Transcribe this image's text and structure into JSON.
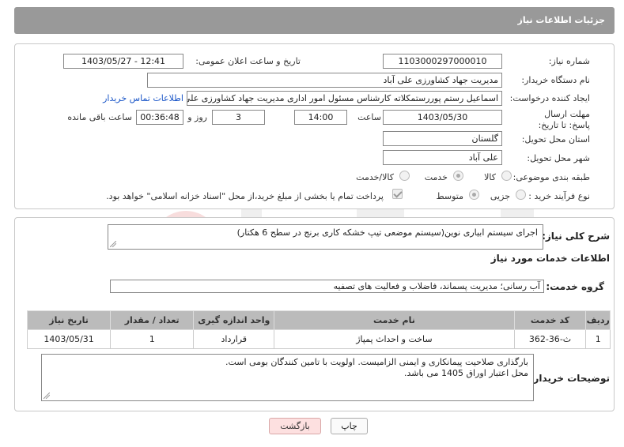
{
  "header": {
    "title": "جزئیات اطلاعات نیاز"
  },
  "need_info": {
    "need_number_label": "شماره نیاز:",
    "need_number": "1103000297000010",
    "announce_label": "تاریخ و ساعت اعلان عمومی:",
    "announce_value": "1403/05/27 - 12:41",
    "buyer_org_label": "نام دستگاه خریدار:",
    "buyer_org": "مدیریت جهاد کشاورزی علی آباد",
    "requester_label": "ایجاد کننده درخواست:",
    "requester": "اسماعیل رستم پوررستمکلاته کارشناس مسئول امور اداری مدیریت جهاد کشاورزی علی آباد",
    "contact_link": "اطلاعات تماس خریدار",
    "deadline_label": "مهلت ارسال پاسخ: تا تاریخ:",
    "deadline_date": "1403/05/30",
    "time_label": "ساعت",
    "deadline_time": "14:00",
    "days_value": "3",
    "days_label": "روز و",
    "remaining_time": "00:36:48",
    "remaining_label": "ساعت باقی مانده",
    "province_label": "استان محل تحویل:",
    "province": "گلستان",
    "city_label": "شهر محل تحویل:",
    "city": "علی آباد",
    "category_label": "طبقه بندی موضوعی:",
    "category_options": [
      "کالا",
      "خدمت",
      "کالا/خدمت"
    ],
    "category_selected": "خدمت",
    "process_label": "نوع فرآیند خرید :",
    "process_options": [
      "جزیی",
      "متوسط"
    ],
    "process_selected": "متوسط",
    "payment_note": "پرداخت تمام یا بخشی از مبلغ خرید،از محل \"اسناد خزانه اسلامی\" خواهد بود."
  },
  "summary": {
    "label": "شرح کلی نیاز:",
    "text": "اجرای سیستم ابیاری نوین(سیستم موضعی تیپ خشکه کاری برنج در سطح 6 هکتار)"
  },
  "services": {
    "section_title": "اطلاعات خدمات مورد نیاز",
    "group_label": "گروه خدمت:",
    "group_value": "آب رسانی؛ مدیریت پسماند، فاضلاب و فعالیت های تصفیه",
    "columns": [
      "ردیف",
      "کد خدمت",
      "نام خدمت",
      "واحد اندازه گیری",
      "تعداد / مقدار",
      "تاریخ نیاز"
    ],
    "rows": [
      [
        "1",
        "ث-36-362",
        "ساخت و احداث پمپاژ",
        "قرارداد",
        "1",
        "1403/05/31"
      ]
    ]
  },
  "buyer_notes": {
    "label": "توضیحات خریدار:",
    "line1": "بارگذاری صلاحیت پیمانکاری و ایمنی الزامیست. اولویت با تامین کنندگان بومی است.",
    "line2": "محل اعتبار اوراق 1405 می باشد."
  },
  "buttons": {
    "print": "چاپ",
    "back": "بازگشت"
  },
  "colors": {
    "header_bg": "#999999",
    "link": "#1a56c8",
    "back_button_bg": "#fde0e0",
    "table_header_bg": "#bbbbbb"
  }
}
